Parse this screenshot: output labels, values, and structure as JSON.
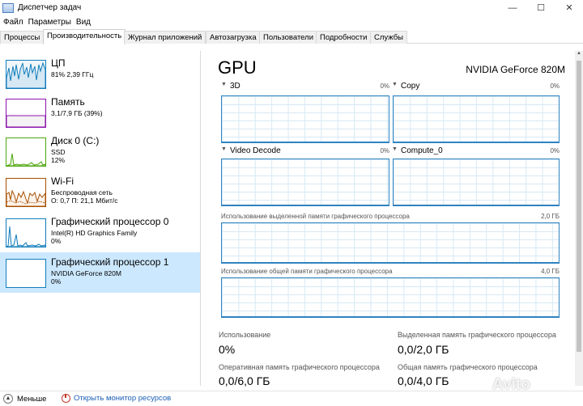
{
  "window": {
    "title": "Диспетчер задач",
    "controls": [
      "—",
      "☐",
      "✕"
    ]
  },
  "menu": [
    "Файл",
    "Параметры",
    "Вид"
  ],
  "tabs": [
    "Процессы",
    "Производительность",
    "Журнал приложений",
    "Автозагрузка",
    "Пользователи",
    "Подробности",
    "Службы"
  ],
  "active_tab": "Производительность",
  "resources": [
    {
      "name": "ЦП",
      "line1": "81% 2,39 ГГц",
      "line2": "",
      "color": "#117dbb",
      "fill": "#f1f6fa"
    },
    {
      "name": "Память",
      "line1": "3,1/7,9 ГБ (39%)",
      "line2": "",
      "color": "#8b12ae",
      "fill": "#f4f2f4"
    },
    {
      "name": "Диск 0 (C:)",
      "line1": "SSD",
      "line2": "12%",
      "color": "#4da60c",
      "fill": "#eff7ea"
    },
    {
      "name": "Wi-Fi",
      "line1": "Беспроводная сеть",
      "line2": "О: 0,7 П: 21,1 Мбит/с",
      "color": "#a74f01",
      "fill": "#fcf3eb"
    },
    {
      "name": "Графический процессор 0",
      "line1": "Intel(R) HD Graphics Family",
      "line2": "0%",
      "color": "#117dbb",
      "fill": "#f1f6fa"
    },
    {
      "name": "Графический процессор 1",
      "line1": "NVIDIA GeForce 820M",
      "line2": "0%",
      "color": "#117dbb",
      "fill": "#ffffff"
    }
  ],
  "gpu": {
    "title": "GPU",
    "model": "NVIDIA GeForce 820M",
    "engines": [
      {
        "name": "3D",
        "pct": "0%"
      },
      {
        "name": "Copy",
        "pct": "0%"
      },
      {
        "name": "Video Decode",
        "pct": "0%"
      },
      {
        "name": "Compute_0",
        "pct": "0%"
      }
    ],
    "dedicated_label": "Использование выделенной памяти графического процессора",
    "dedicated_max": "2,0 ГБ",
    "shared_label": "Использование общей памяти графического процессора",
    "shared_max": "4,0 ГБ",
    "stats": {
      "usage_label": "Использование",
      "usage_value": "0%",
      "dedicated_label": "Выделенная память графического процессора",
      "dedicated_value": "0,0/2,0 ГБ",
      "ram_label": "Оперативная память графического процессора",
      "ram_value": "0,0/6,0 ГБ",
      "shared_label": "Общая память графического процессора",
      "shared_value": "0,0/4,0 ГБ"
    }
  },
  "footer": {
    "fewer": "Меньше",
    "monitor": "Открыть монитор ресурсов"
  },
  "watermark": "Avito"
}
